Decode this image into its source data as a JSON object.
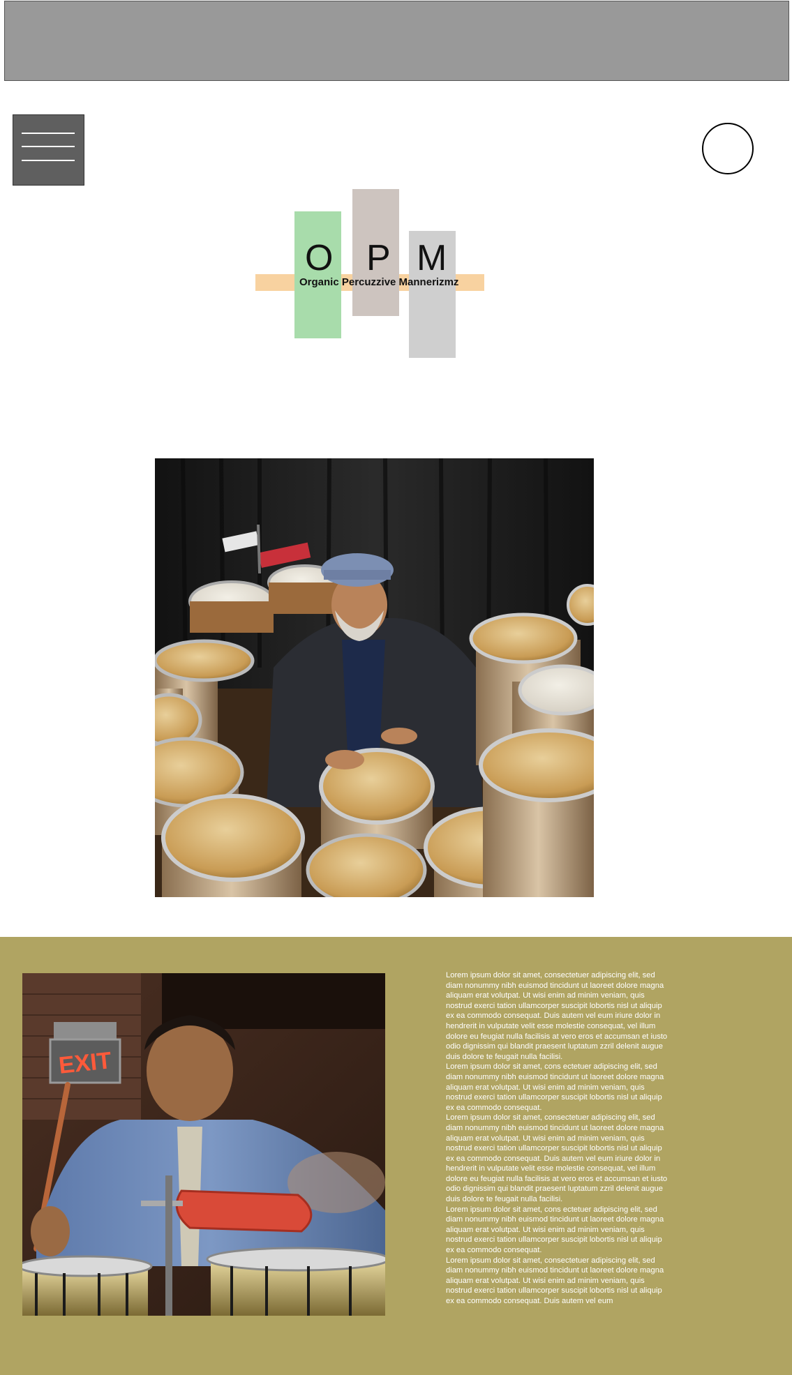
{
  "logo": {
    "letters": [
      "O",
      "P",
      "M"
    ],
    "tagline": "Organic Percuzzive Mannerizmz",
    "colors": {
      "green": "#a8dcab",
      "taupe": "#cdc4bf",
      "gray": "#cfcfcf",
      "band": "#f8d2a0"
    }
  },
  "icons": {
    "menu": "hamburger-menu-icon",
    "circle": "circle-icon"
  },
  "photos": {
    "hero": "percussionist-with-conga-drums",
    "second": "drummer-playing-under-exit-sign",
    "exit_sign": "EXIT"
  },
  "colors": {
    "banner": "#999999",
    "menu_button": "#5f5f5f",
    "section_bg": "#b0a462"
  },
  "content": {
    "paragraphs": [
      "Lorem ipsum dolor sit amet, consectetuer adipiscing elit, sed diam nonummy nibh euismod tincidunt ut laoreet dolore magna aliquam erat volutpat. Ut wisi enim ad minim veniam, quis nostrud exerci tation ullamcorper suscipit lobortis nisl ut aliquip ex ea commodo consequat. Duis autem vel eum iriure dolor in hendrerit in vulputate velit esse molestie consequat, vel illum dolore eu feugiat nulla facilisis at vero eros et accumsan et iusto odio dignissim qui blandit praesent luptatum zzril delenit augue duis dolore te feugait nulla facilisi.",
      "Lorem ipsum dolor sit amet, cons ectetuer adipiscing elit, sed diam nonummy nibh euismod tincidunt ut laoreet dolore magna aliquam erat volutpat. Ut wisi enim ad minim veniam, quis nostrud exerci tation ullamcorper suscipit lobortis nisl ut aliquip ex ea commodo consequat.",
      "Lorem ipsum dolor sit amet, consectetuer adipiscing elit, sed diam nonummy nibh euismod tincidunt ut laoreet dolore magna aliquam erat volutpat. Ut wisi enim ad minim veniam, quis nostrud exerci tation ullamcorper suscipit lobortis nisl ut aliquip ex ea commodo consequat. Duis autem vel eum iriure dolor in hendrerit in vulputate velit esse molestie consequat, vel illum dolore eu feugiat nulla facilisis at vero eros et accumsan et iusto odio dignissim qui blandit praesent luptatum zzril delenit augue duis dolore te feugait nulla facilisi.",
      "Lorem ipsum dolor sit amet, cons ectetuer adipiscing elit, sed diam nonummy nibh euismod tincidunt ut laoreet dolore magna aliquam erat volutpat. Ut wisi enim ad minim veniam, quis nostrud exerci tation ullamcorper suscipit lobortis nisl ut aliquip ex ea commodo consequat.",
      "Lorem ipsum dolor sit amet, consectetuer adipiscing elit, sed diam nonummy nibh euismod tincidunt ut laoreet dolore magna aliquam erat volutpat. Ut wisi enim ad minim veniam, quis nostrud exerci tation ullamcorper suscipit lobortis nisl ut aliquip ex ea commodo consequat. Duis autem vel eum"
    ]
  }
}
